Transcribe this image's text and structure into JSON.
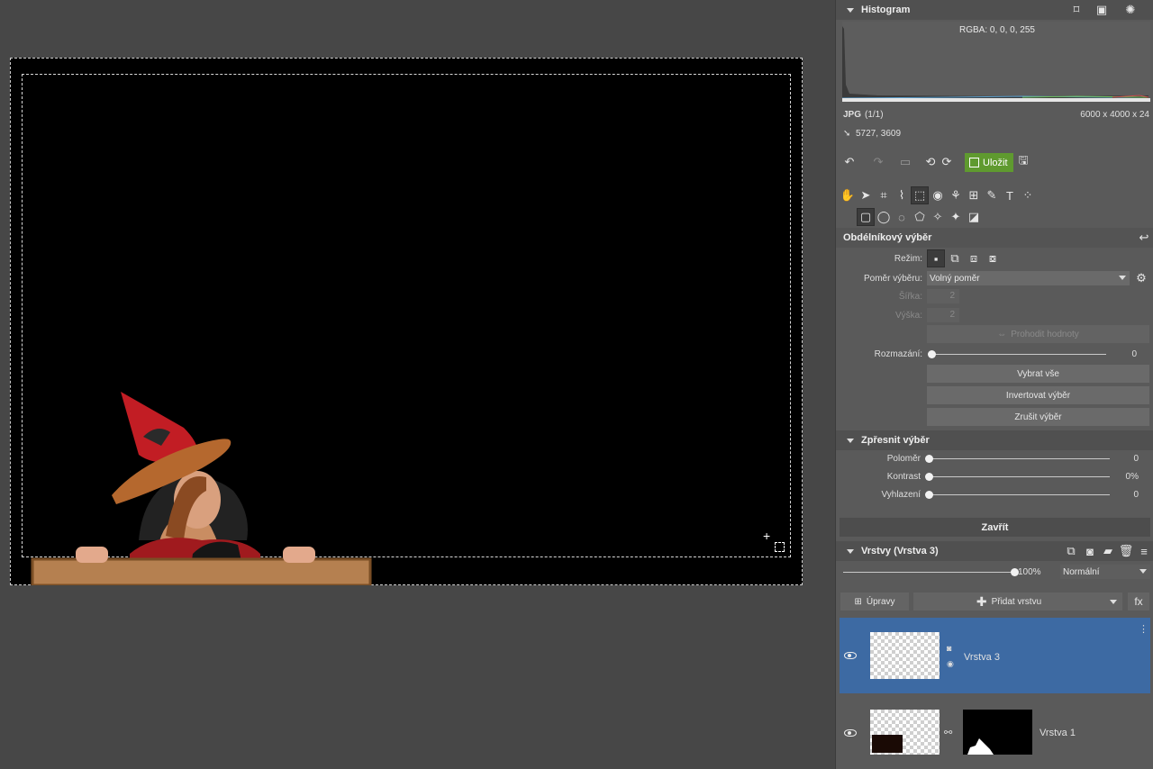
{
  "canvas": {
    "background": "#000000"
  },
  "histogram": {
    "title": "Histogram",
    "rgba_readout": "RGBA:   0,    0,    0,  255"
  },
  "file_info": {
    "format": "JPG",
    "count": "(1/1)",
    "dimensions": "6000 x 4000 x 24",
    "cursor_position": "5727, 3609"
  },
  "toolbar": {
    "save_label": "Uložit",
    "save_color": "#5f9a2f"
  },
  "selection_tool": {
    "title": "Obdélníkový výběr",
    "mode_label": "Režim:",
    "ratio_label": "Poměr výběru:",
    "ratio_value": "Volný poměr",
    "width_label": "Šířka:",
    "width_value": "2",
    "height_label": "Výška:",
    "height_value": "2",
    "swap_label": "Prohodit hodnoty",
    "blur_label": "Rozmazání:",
    "blur_value": "0",
    "select_all": "Vybrat vše",
    "invert": "Invertovat výběr",
    "cancel": "Zrušit výběr"
  },
  "refine": {
    "title": "Zpřesnit výběr",
    "radius_label": "Poloměr",
    "radius_value": "0",
    "contrast_label": "Kontrast",
    "contrast_value": "0%",
    "smooth_label": "Vyhlazení",
    "smooth_value": "0"
  },
  "close_label": "Zavřít",
  "layers": {
    "title": "Vrstvy (Vrstva 3)",
    "opacity": "100%",
    "blend_mode": "Normální",
    "adjust_label": "Úpravy",
    "add_label": "Přidat vrstvu",
    "fx_label": "fx",
    "selected_color": "#3d6aa3",
    "items": [
      {
        "name": "Vrstva 3",
        "selected": true
      },
      {
        "name": "Vrstva 1",
        "selected": false
      }
    ]
  }
}
